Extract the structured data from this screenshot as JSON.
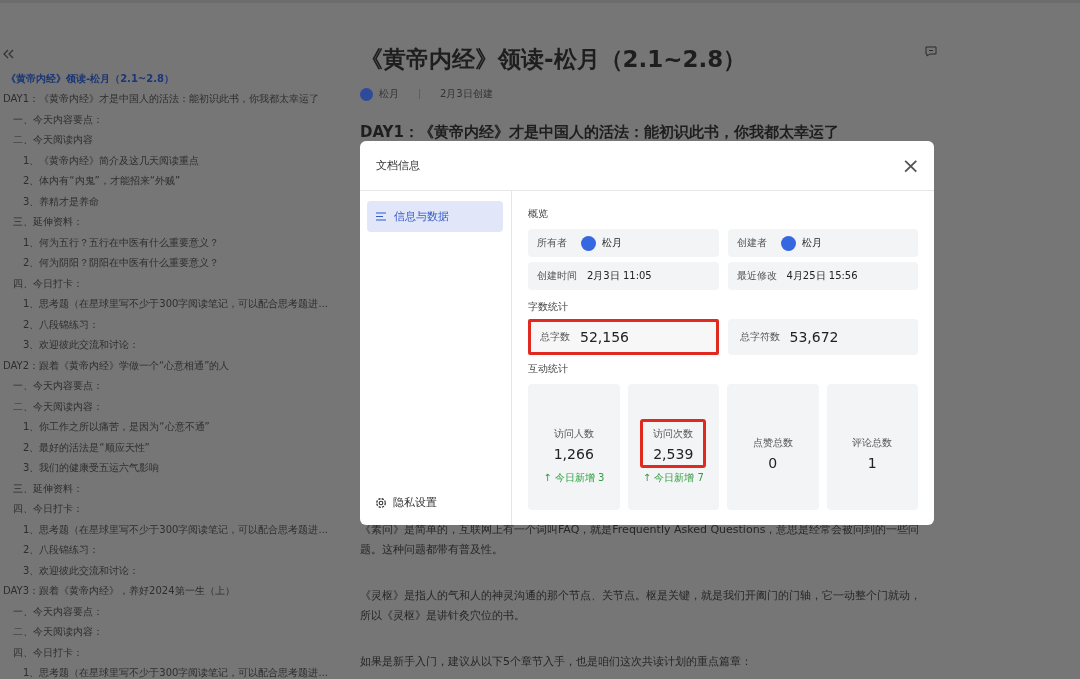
{
  "outline": {
    "title": "《黄帝内经》领读-松月（2.1~2.8）",
    "items": [
      {
        "text": "DAY1：《黄帝内经》才是中国人的活法：能初识此书，你我都太幸运了",
        "children": [
          {
            "text": "一、今天内容要点："
          },
          {
            "text": "二、今天阅读内容",
            "children": [
              {
                "text": "1、《黄帝内经》简介及这几天阅读重点"
              },
              {
                "text": "2、体内有“内鬼”，才能招来“外贼”"
              },
              {
                "text": "3、养精才是养命"
              }
            ]
          },
          {
            "text": "三、延伸资料：",
            "children": [
              {
                "text": "1、何为五行？五行在中医有什么重要意义？"
              },
              {
                "text": "2、何为阴阳？阴阳在中医有什么重要意义？"
              }
            ]
          },
          {
            "text": "四、今日打卡：",
            "children": [
              {
                "text": "1、思考题（在星球里写不少于300字阅读笔记，可以配合思考题进..."
              },
              {
                "text": "2、八段锦练习："
              },
              {
                "text": "3、欢迎彼此交流和讨论："
              }
            ]
          }
        ]
      },
      {
        "text": "DAY2：跟着《黄帝内经》学做一个“心意相通”的人",
        "children": [
          {
            "text": "一、今天内容要点："
          },
          {
            "text": "二、今天阅读内容：",
            "children": [
              {
                "text": "1、你工作之所以痛苦，是因为“心意不通”"
              },
              {
                "text": "2、最好的活法是“顺应天性”"
              },
              {
                "text": "3、我们的健康受五运六气影响"
              }
            ]
          },
          {
            "text": "三、延伸资料："
          },
          {
            "text": "四、今日打卡：",
            "children": [
              {
                "text": "1、思考题（在星球里写不少于300字阅读笔记，可以配合思考题进..."
              },
              {
                "text": "2、八段锦练习："
              },
              {
                "text": "3、欢迎彼此交流和讨论："
              }
            ]
          }
        ]
      },
      {
        "text": "DAY3：跟着《黄帝内经》，养好2024第一生（上）",
        "children": [
          {
            "text": "一、今天内容要点："
          },
          {
            "text": "二、今天阅读内容："
          },
          {
            "text": "四、今日打卡：",
            "children": [
              {
                "text": "1、思考题（在星球里写不少于300字阅读笔记，可以配合思考题进..."
              }
            ]
          }
        ]
      }
    ]
  },
  "document": {
    "title": "《黄帝内经》领读-松月（2.1~2.8）",
    "author": "松月",
    "created": "2月3日创建",
    "heading": "DAY1：《黄帝内经》才是中国人的活法：能初识此书，你我都太幸运了",
    "paragraphs": [
      "《素问》是简单的，互联网上有一个词叫FAQ，就是Frequently Asked Questions，意思是经常会被问到的一些问题。这种问题都带有普及性。",
      "《灵枢》是指人的气和人的神灵沟通的那个节点、关节点。枢是关键，就是我们开阖门的门轴，它一动整个门就动，所以《灵枢》是讲针灸穴位的书。",
      "如果是新手入门，建议从以下5个章节入手，也是咱们这次共读计划的重点篇章："
    ]
  },
  "dialog": {
    "title": "文档信息",
    "close": "×",
    "nav": [
      {
        "label": "信息与数据",
        "selected": true
      }
    ],
    "privacy": "隐私设置",
    "overview": {
      "heading": "概览",
      "fields": [
        {
          "label": "所有者",
          "value": "松月",
          "kind": "person"
        },
        {
          "label": "创建者",
          "value": "松月",
          "kind": "person"
        },
        {
          "label": "创建时间",
          "value": "2月3日 11:05",
          "kind": "text"
        },
        {
          "label": "最近修改",
          "value": "4月25日 15:56",
          "kind": "text"
        }
      ]
    },
    "word_count": {
      "heading": "字数统计",
      "fields": [
        {
          "label": "总字数",
          "value": "52,156",
          "highlighted": true
        },
        {
          "label": "总字符数",
          "value": "53,672",
          "highlighted": false
        }
      ]
    },
    "interaction": {
      "heading": "互动统计",
      "stats": [
        {
          "label": "访问人数",
          "value": "1,266",
          "delta": "↑ 今日新增 3",
          "highlighted": false
        },
        {
          "label": "访问次数",
          "value": "2,539",
          "delta": "↑ 今日新增 7",
          "highlighted": true
        },
        {
          "label": "点赞总数",
          "value": "0",
          "highlighted": false
        },
        {
          "label": "评论总数",
          "value": "1",
          "highlighted": false
        }
      ]
    }
  }
}
